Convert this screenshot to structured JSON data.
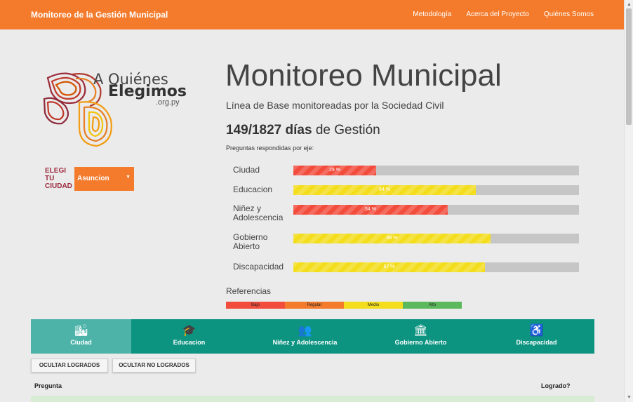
{
  "header": {
    "brand": "Monitoreo de la Gestión Municipal",
    "nav": [
      "Metodología",
      "Acerca del Proyecto",
      "Quiénes Somos"
    ]
  },
  "logo": {
    "line1": "A Quiénes",
    "line2": "Elegimos",
    "line3": ".org.py"
  },
  "city": {
    "label_line1": "ELEGI",
    "label_line2": "TU",
    "label_line3": "CIUDAD",
    "selected": "Asuncion"
  },
  "main": {
    "title": "Monitoreo Municipal",
    "subtitle": "Línea de Base monitoreadas por la Sociedad Civil",
    "days_value": "149/1827 días",
    "days_suffix": " de Gestión",
    "questions_label": "Preguntas respondidas por eje:"
  },
  "progress": [
    {
      "name": "Ciudad",
      "label": "29 %",
      "value": 29,
      "color": "#f24c3c"
    },
    {
      "name": "Educacion",
      "label": "64 %",
      "value": 64,
      "color": "#f3dd1d"
    },
    {
      "name": "Niñez y Adolescencia",
      "label": "54 %",
      "value": 54,
      "color": "#f24c3c"
    },
    {
      "name": "Gobierno Abierto",
      "label": "69 %",
      "value": 69,
      "color": "#f3dd1d"
    },
    {
      "name": "Discapacidad",
      "label": "67 %",
      "value": 67,
      "color": "#f3dd1d"
    }
  ],
  "references": {
    "title": "Referencias",
    "items": [
      {
        "label": "Bajo",
        "color": "#f24c3c"
      },
      {
        "label": "Regular",
        "color": "#f47b2c"
      },
      {
        "label": "Medio",
        "color": "#f3dd1d"
      },
      {
        "label": "Alto",
        "color": "#5cb85c"
      }
    ]
  },
  "tabs": [
    {
      "label": "Ciudad",
      "icon": "city-icon",
      "glyph": "🏙",
      "active": true
    },
    {
      "label": "Educacion",
      "icon": "graduation-cap-icon",
      "glyph": "🎓",
      "active": false
    },
    {
      "label": "Niñez y Adolescencia",
      "icon": "children-icon",
      "glyph": "👥",
      "active": false
    },
    {
      "label": "Gobierno Abierto",
      "icon": "government-building-icon",
      "glyph": "🏛",
      "active": false
    },
    {
      "label": "Discapacidad",
      "icon": "wheelchair-icon",
      "glyph": "♿",
      "active": false
    }
  ],
  "buttons": {
    "hide_achieved": "OCULTAR LOGRADOS",
    "hide_not_achieved": "OCULTAR NO LOGRADOS"
  },
  "table": {
    "col_question": "Pregunta",
    "col_achieved": "Logrado?"
  }
}
